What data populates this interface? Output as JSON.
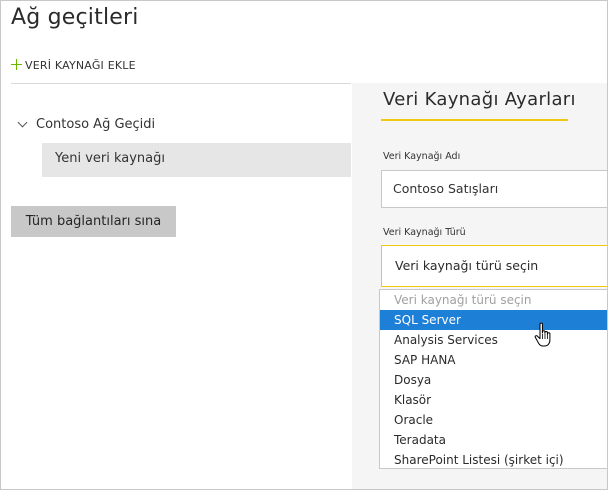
{
  "page": {
    "title": "Ağ geçitleri",
    "add_datasource_label": "VERİ KAYNAĞI EKLE"
  },
  "tree": {
    "gateway_name": "Contoso Ağ Geçidi",
    "datasource_item": "Yeni veri kaynağı"
  },
  "actions": {
    "test_all_label": "Tüm bağlantıları sına"
  },
  "settings": {
    "title": "Veri Kaynağı Ayarları",
    "name_label": "Veri Kaynağı Adı",
    "name_value": "Contoso Satışları",
    "type_label": "Veri Kaynağı Türü",
    "type_value": "Veri kaynağı türü seçin"
  },
  "dropdown": {
    "options": [
      "Veri kaynağı türü seçin",
      "SQL Server",
      "Analysis Services",
      "SAP HANA",
      "Dosya",
      "Klasör",
      "Oracle",
      "Teradata",
      "SharePoint Listesi (şirket içi)"
    ],
    "selected": "SQL Server"
  },
  "colors": {
    "accent_yellow": "#f2c811",
    "plus_green": "#6bb700",
    "selection_blue": "#1e7fd6",
    "panel_bg": "#f5f5f5",
    "button_gray": "#c8c8c8"
  },
  "icons": {
    "add": "plus-icon",
    "expand": "chevron-down-icon",
    "pointer": "hand-cursor-icon"
  }
}
